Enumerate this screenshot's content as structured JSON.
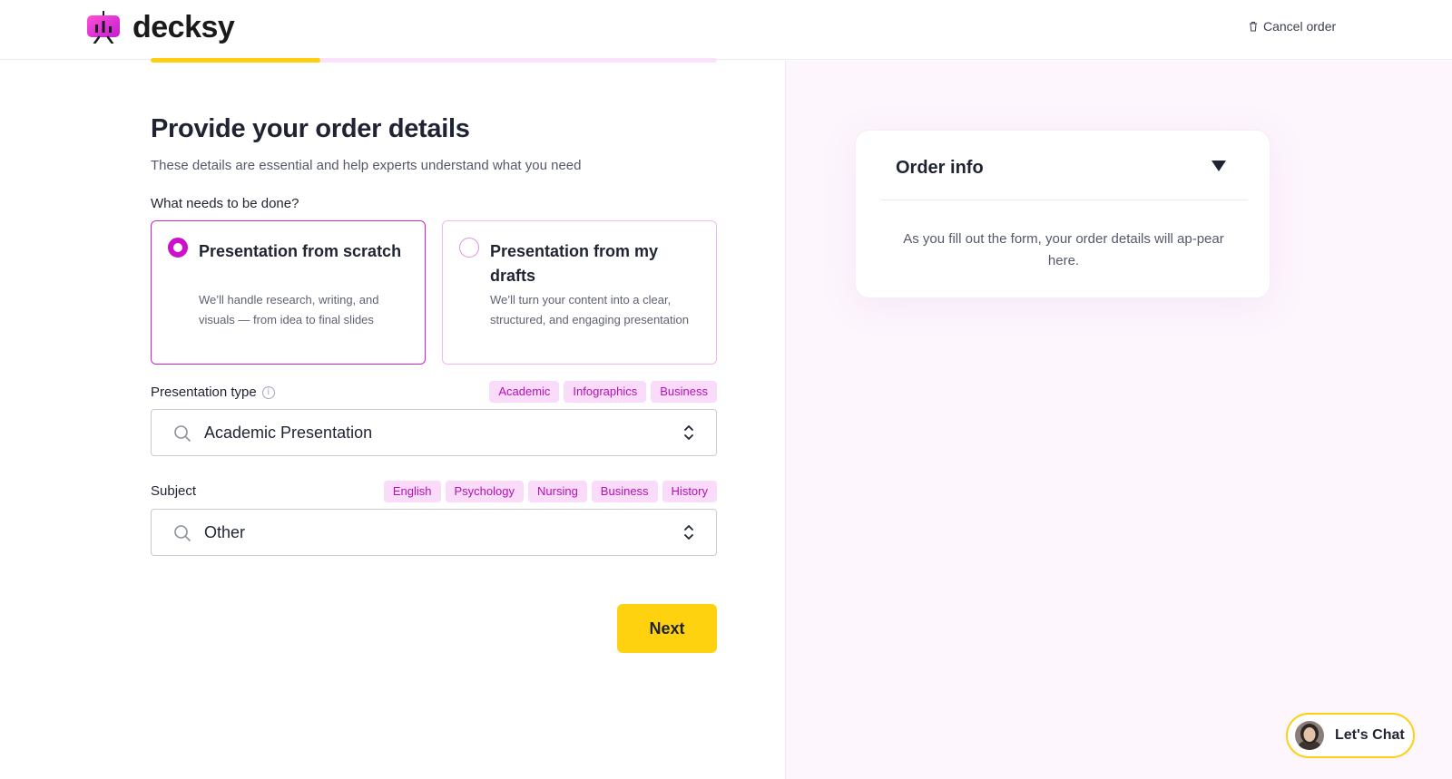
{
  "brand": {
    "name": "decksy",
    "accent": "#cc11cc",
    "yellow": "#ffd20f"
  },
  "header": {
    "cancel_label": "Cancel order",
    "cancel_icon": "trash-icon"
  },
  "progress": {
    "fraction": 0.3
  },
  "form": {
    "title": "Provide your order details",
    "subtitle": "These details are essential and help experts understand what you need",
    "question": "What needs to be done?",
    "options": [
      {
        "title": "Presentation from scratch",
        "desc": "We’ll handle research, writing, and visuals — from idea to final slides",
        "selected": true
      },
      {
        "title": "Presentation from my drafts",
        "desc": "We’ll turn your content into a clear, structured, and engaging presentation",
        "selected": false
      }
    ],
    "presentation_type": {
      "label": "Presentation type",
      "chips": [
        "Academic",
        "Infographics",
        "Business"
      ],
      "value": "Academic Presentation"
    },
    "subject": {
      "label": "Subject",
      "chips": [
        "English",
        "Psychology",
        "Nursing",
        "Business",
        "History"
      ],
      "value": "Other"
    },
    "next_label": "Next"
  },
  "order_info": {
    "title": "Order info",
    "text": "As you fill out the form, your order details will ap-pear here."
  },
  "chat": {
    "label": "Let's Chat"
  }
}
